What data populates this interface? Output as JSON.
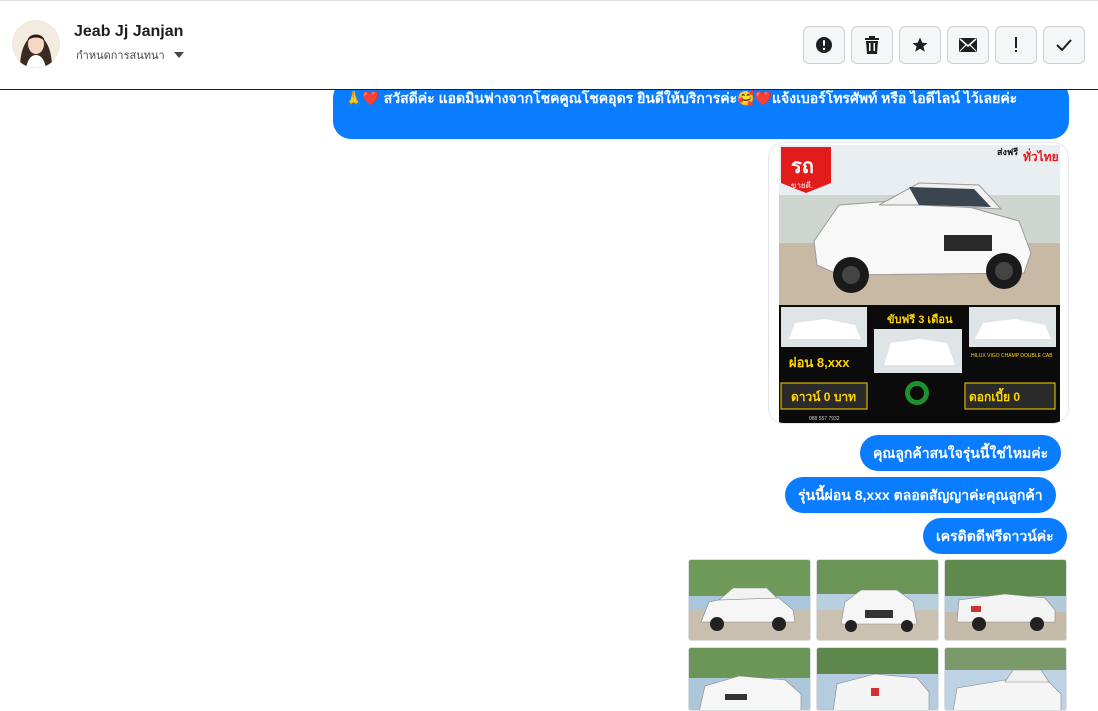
{
  "contact": {
    "name": "Jeab Jj Janjan",
    "assign_label": "กำหนดการสนทนา"
  },
  "actions": [
    {
      "icon": "alert-circle-icon",
      "name": "mark-spam-button"
    },
    {
      "icon": "trash-icon",
      "name": "delete-button"
    },
    {
      "icon": "star-icon",
      "name": "star-button"
    },
    {
      "icon": "envelope-icon",
      "name": "mark-unread-button"
    },
    {
      "icon": "exclamation-icon",
      "name": "follow-up-button"
    },
    {
      "icon": "check-icon",
      "name": "mark-done-button"
    }
  ],
  "messages": {
    "greeting": "🙏❤️ สวัสดีค่ะ แอดมินฟางจากโชคคูณโชคอุดร ยินดีให้บริการค่ะ🥰❤️แจ้งเบอร์โทรศัพท์ หรือ ไอดีไลน์  ไว้เลยค่ะ",
    "ask_interest": "คุณลูกค้าสนใจรุ่นนี้ใช่ไหมค่ะ",
    "installment": "รุ่นนี้ผ่อน 8,xxx ตลอดสัญญาค่ะคุณลูกค้า",
    "credit": "เครดิตดีฟรีดาวน์ค่ะ"
  },
  "promo_image": {
    "free_shipping": "ส่งฟรี",
    "nationwide": "ทั่วไทย",
    "brand": "รถ",
    "brand_sub": "ขายดี.",
    "drive_free": "ขับฟรี 3 เดือน",
    "installment": "ผ่อน 8,xxx",
    "down": "ดาวน์ 0 บาท",
    "interest": "ดอกเบี้ย 0",
    "model": "HILUX VIGO CHAMP DOUBLE CAB",
    "phone": "088 557 7932"
  },
  "colors": {
    "bubble": "#0a7cff",
    "promo_bg": "#0b0b0b",
    "promo_yellow": "#ffd400",
    "promo_red": "#e21b1b"
  }
}
